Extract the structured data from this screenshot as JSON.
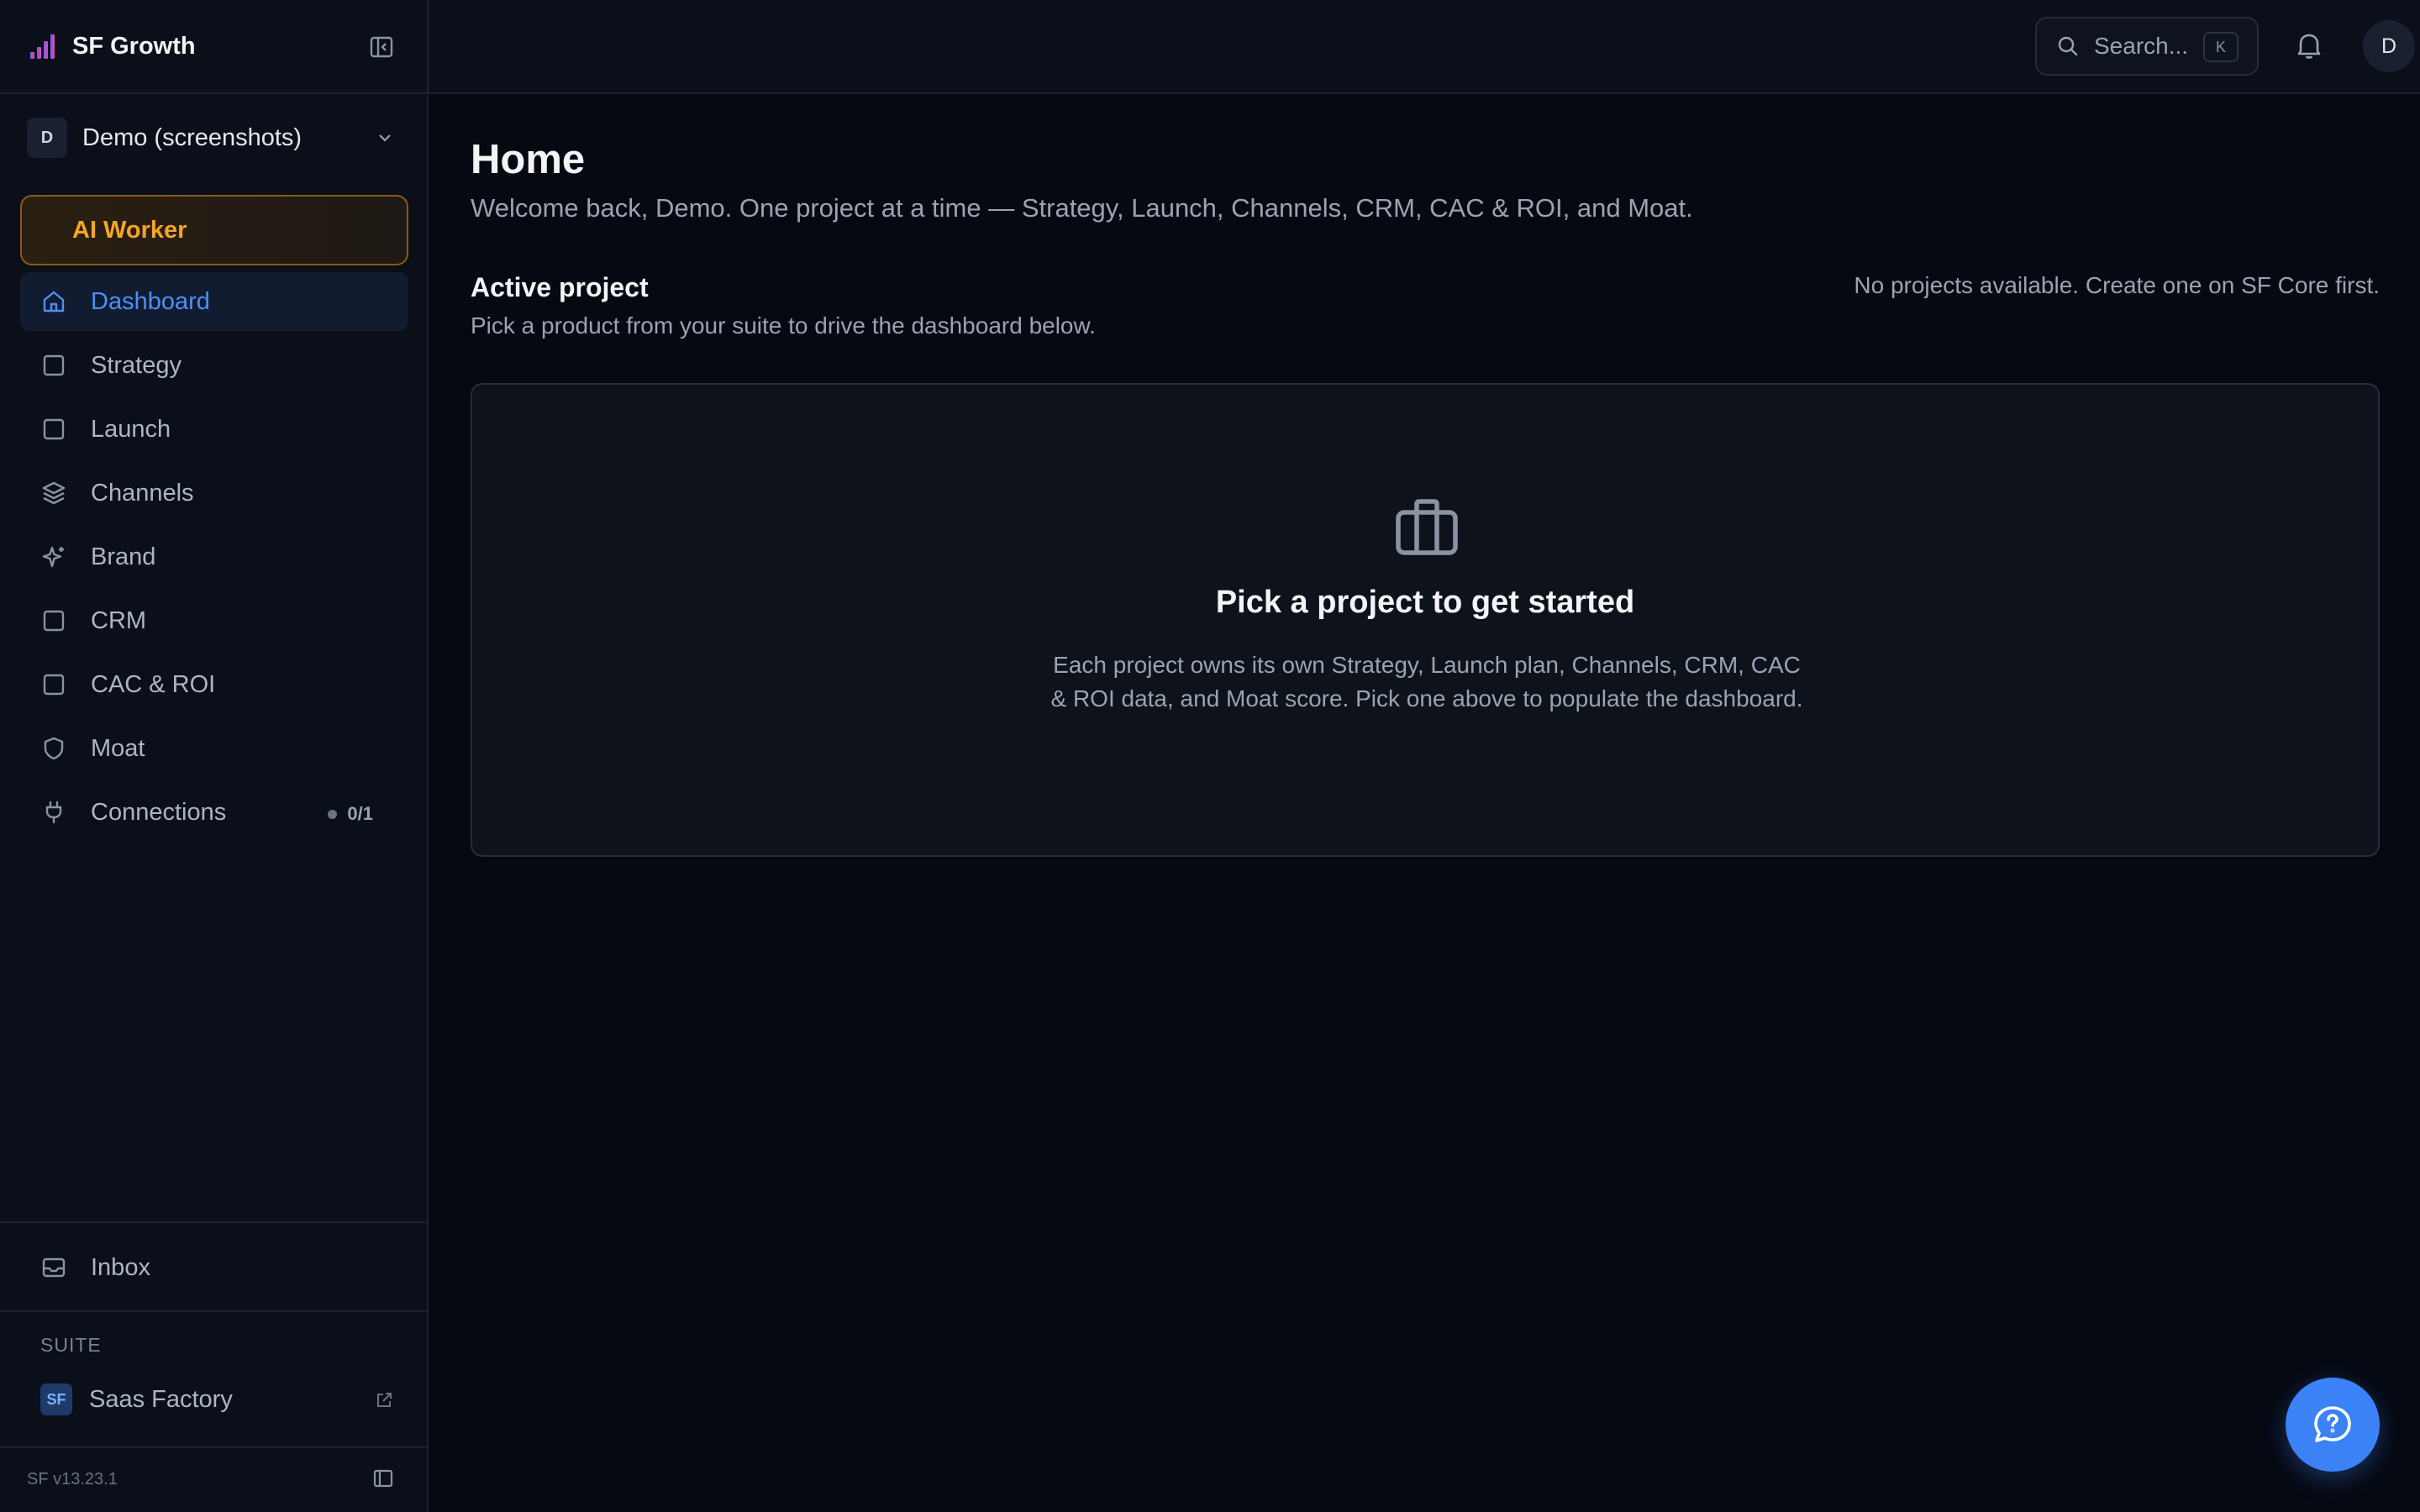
{
  "app": {
    "name": "SF Growth"
  },
  "workspace": {
    "initial": "D",
    "name": "Demo (screenshots)"
  },
  "sidebar": {
    "ai_worker_label": "AI Worker",
    "items": [
      {
        "label": "Dashboard",
        "icon": "home-icon",
        "active": true
      },
      {
        "label": "Strategy",
        "icon": "square-icon"
      },
      {
        "label": "Launch",
        "icon": "square-icon"
      },
      {
        "label": "Channels",
        "icon": "layers-icon"
      },
      {
        "label": "Brand",
        "icon": "sparkles-icon"
      },
      {
        "label": "CRM",
        "icon": "square-icon"
      },
      {
        "label": "CAC & ROI",
        "icon": "square-icon"
      },
      {
        "label": "Moat",
        "icon": "shield-icon"
      },
      {
        "label": "Connections",
        "icon": "plug-icon",
        "badge": "0/1"
      }
    ],
    "inbox_label": "Inbox",
    "suite_label": "SUITE",
    "suite_item": {
      "badge": "SF",
      "label": "Saas Factory"
    },
    "version": "SF v13.23.1"
  },
  "topbar": {
    "search_placeholder": "Search...",
    "search_shortcut": "K",
    "user_initial": "D"
  },
  "main": {
    "title": "Home",
    "subtitle": "Welcome back, Demo. One project at a time — Strategy, Launch, Channels, CRM, CAC & ROI, and Moat.",
    "active_project": {
      "title": "Active project",
      "description": "Pick a product from your suite to drive the dashboard below.",
      "status": "No projects available. Create one on SF Core first."
    },
    "empty_state": {
      "title": "Pick a project to get started",
      "description": "Each project owns its own Strategy, Launch plan, Channels, CRM, CAC & ROI data, and Moat score. Pick one above to populate the dashboard."
    }
  },
  "colors": {
    "accent": "#3b82f6",
    "active_nav_text": "#4f8ff7",
    "ai_worker": "#f5a524",
    "background": "#060912",
    "sidebar": "#0b0f19"
  }
}
